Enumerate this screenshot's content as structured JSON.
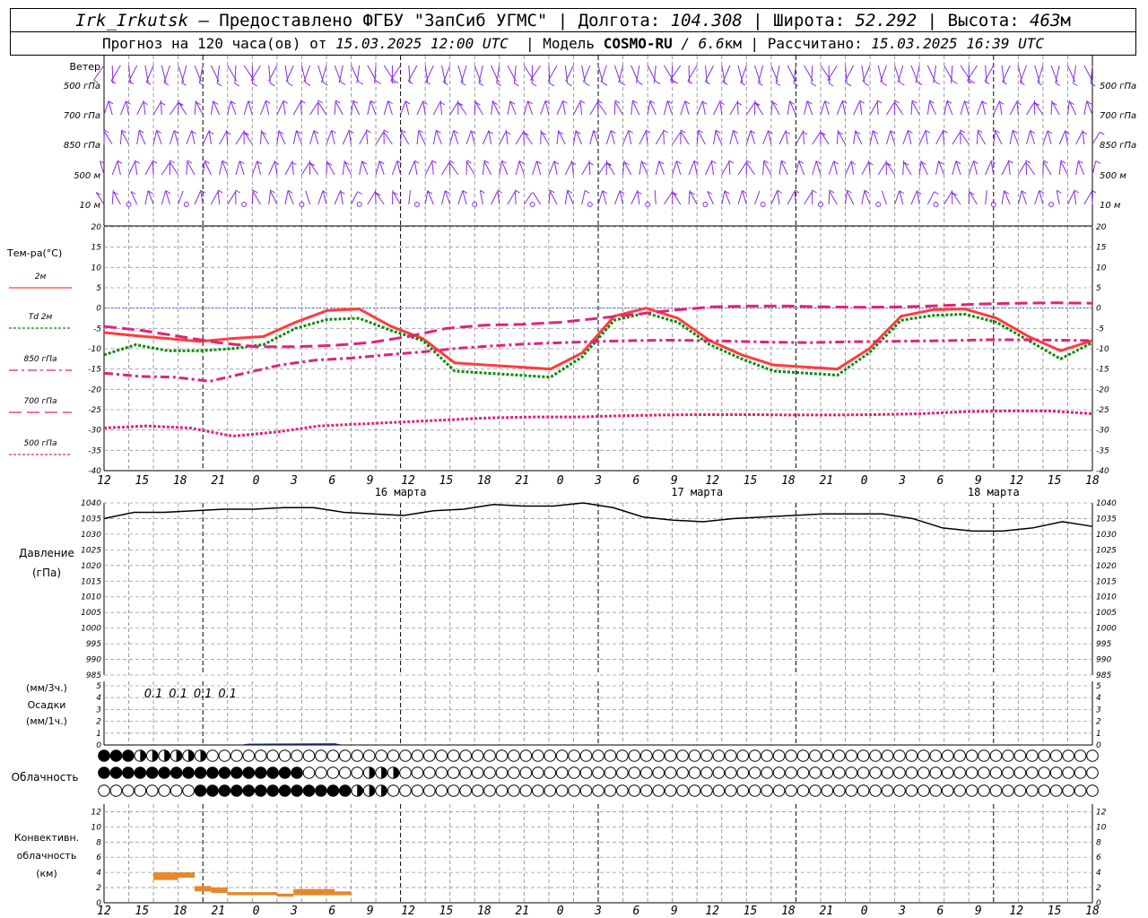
{
  "header": {
    "station": "Irk_Irkutsk",
    "provider": "— Предоставлено ФГБУ \"ЗапСиб УГМС\"",
    "lon_label": "Долгота:",
    "lon": "104.308",
    "lat_label": "Широта:",
    "lat": "52.292",
    "alt_label": "Высота:",
    "alt": "463",
    "alt_unit": "м",
    "forecast_label": "Прогноз на 120 часа(ов) от",
    "forecast_start": "15.03.2025 12:00 UTC",
    "model_label": "Модель",
    "model": "COSMO-RU",
    "resolution": "/ 6.6",
    "res_unit": "км",
    "calc_label": "Рассчитано:",
    "calc_time": "15.03.2025 16:39 UTC"
  },
  "chart_data": [
    {
      "type": "wind-barbs",
      "title": "Ветер",
      "levels": [
        "500 гПа",
        "700 гПа",
        "850 гПа",
        "500 м",
        "10 м"
      ]
    },
    {
      "type": "line",
      "ylabel": "Тем-ра(°C)",
      "ylim": [
        -40,
        20
      ],
      "yticks": [
        20,
        15,
        10,
        5,
        0,
        -5,
        -10,
        -15,
        -20,
        -25,
        -30,
        -35,
        -40
      ],
      "x_hours_from_start": [
        0,
        3,
        6,
        9,
        12,
        15,
        18,
        21,
        24,
        27,
        30,
        33,
        36,
        39,
        42,
        45,
        48,
        51,
        54,
        57,
        60,
        63,
        66,
        69,
        72,
        75,
        78,
        81,
        84,
        87,
        90,
        93,
        96,
        99,
        102,
        105,
        108,
        111,
        114,
        117,
        120
      ],
      "series": [
        {
          "name": "2м",
          "color": "#ff3c3c",
          "style": "solid",
          "values": [
            -6,
            -6.8,
            -7.5,
            -8.2,
            -7.5,
            -7,
            -3.5,
            -0.6,
            -0.2,
            -4.5,
            -7.5,
            -13.5,
            -14,
            -14.5,
            -15,
            -11,
            -2,
            0,
            -2.5,
            -8,
            -11.5,
            -14,
            -14.5,
            -15,
            -10,
            -2,
            -0.4,
            -0.2,
            -2.5,
            -7,
            -10.5,
            -8
          ]
        },
        {
          "name": "Td 2м",
          "color": "#0a8a0a",
          "style": "dotted",
          "values": [
            -11.5,
            -9,
            -10.5,
            -10.5,
            -10,
            -9,
            -5,
            -2.8,
            -2.5,
            -5.5,
            -8,
            -15.5,
            -16,
            -16.5,
            -17,
            -12,
            -3,
            -1.2,
            -3.5,
            -9,
            -12.5,
            -15.5,
            -16,
            -16.5,
            -11,
            -3,
            -1.8,
            -1.5,
            -3.5,
            -8,
            -12.5,
            -8.5
          ]
        },
        {
          "name": "850 гПа",
          "color": "#e0237a",
          "style": "dashdot",
          "values": [
            -16,
            -16.8,
            -17,
            -18,
            -16,
            -14,
            -12.8,
            -12.3,
            -11.5,
            -10.8,
            -9.9,
            -9.3,
            -8.8,
            -8.5,
            -8.2,
            -8,
            -7.9,
            -8,
            -8.2,
            -8.4,
            -8.5,
            -8.3,
            -8.2,
            -8.1,
            -8,
            -7.8,
            -7.8,
            -7.9,
            -8
          ]
        },
        {
          "name": "700 гПа",
          "color": "#e0237a",
          "style": "dashed",
          "values": [
            -4.5,
            -5.5,
            -7,
            -8.5,
            -9.5,
            -9.5,
            -9.2,
            -8.5,
            -7,
            -5,
            -4.2,
            -4,
            -3.5,
            -2.5,
            -1.5,
            -0.5,
            0.3,
            0.5,
            0.5,
            0.3,
            0.2,
            0.3,
            0.6,
            1,
            1.2,
            1.3,
            1.2
          ]
        },
        {
          "name": "500 гПа",
          "color": "#e0237a",
          "style": "dotted",
          "values": [
            -29.5,
            -29,
            -29.5,
            -31.5,
            -30.5,
            -29,
            -28.5,
            -28,
            -27.5,
            -27,
            -26.8,
            -26.8,
            -26.5,
            -26.3,
            -26.2,
            -26.2,
            -26.3,
            -26.3,
            -26.2,
            -26,
            -25.5,
            -25.3,
            -25.3,
            -26
          ]
        }
      ]
    },
    {
      "type": "line",
      "ylabel": "Давление",
      "yunit": "(гПа)",
      "ylim": [
        985,
        1040
      ],
      "yticks": [
        1040,
        1035,
        1030,
        1025,
        1020,
        1015,
        1010,
        1005,
        1000,
        995,
        990,
        985
      ],
      "x_hours_from_start": [
        0,
        3,
        6,
        9,
        12,
        15,
        18,
        21,
        24,
        27,
        30,
        33,
        36,
        39,
        42,
        45,
        48,
        51,
        54,
        57,
        60,
        63,
        66,
        69,
        72,
        75,
        78,
        81,
        84,
        87,
        90,
        93,
        96,
        99,
        102,
        105,
        108,
        111,
        114,
        117,
        120
      ],
      "series": [
        {
          "name": "Давление",
          "color": "#000000",
          "values": [
            1035,
            1037,
            1037,
            1037.5,
            1038,
            1038,
            1038.5,
            1038.5,
            1037,
            1036.5,
            1036,
            1037.5,
            1038,
            1039.5,
            1039,
            1039,
            1040,
            1038.5,
            1035.5,
            1034.5,
            1034,
            1035,
            1035.5,
            1036,
            1036.5,
            1036.5,
            1036.5,
            1035,
            1032,
            1031,
            1031,
            1032,
            1034,
            1032.5
          ]
        }
      ]
    },
    {
      "type": "bar",
      "ylabel": "Осадки",
      "yunit_top": "(мм/3ч.)",
      "yunit_bottom": "(мм/1ч.)",
      "ylim": [
        0,
        5
      ],
      "yticks": [
        5,
        4,
        3,
        2,
        1,
        0
      ],
      "labels": [
        "0.1",
        "0.1",
        "0.1",
        "0.1"
      ],
      "label_hours": [
        33,
        36,
        39,
        42
      ]
    },
    {
      "type": "cloud-circles",
      "ylabel": "Облачность",
      "rows": 3
    },
    {
      "type": "bar",
      "ylabel": "Конвективн. облачность (км)",
      "ylim": [
        0,
        13
      ],
      "yticks": [
        12,
        10,
        8,
        6,
        4,
        2,
        0
      ],
      "segments": [
        {
          "h0": 18,
          "h1": 21,
          "top": 4,
          "bottom": 3
        },
        {
          "h0": 21,
          "h1": 23,
          "top": 4,
          "bottom": 3.3
        },
        {
          "h0": 23,
          "h1": 25,
          "top": 2.2,
          "bottom": 1.5
        },
        {
          "h0": 25,
          "h1": 27,
          "top": 2,
          "bottom": 1.3
        },
        {
          "h0": 27,
          "h1": 33,
          "top": 1.4,
          "bottom": 1.0
        },
        {
          "h0": 33,
          "h1": 35,
          "top": 1.2,
          "bottom": 0.8
        },
        {
          "h0": 35,
          "h1": 40,
          "top": 1.8,
          "bottom": 1.0
        },
        {
          "h0": 40,
          "h1": 42,
          "top": 1.5,
          "bottom": 1.0
        }
      ]
    }
  ],
  "time_axis": {
    "tick_labels": [
      "12",
      "15",
      "18",
      "21",
      "0",
      "3",
      "6",
      "9",
      "12",
      "15",
      "18",
      "21",
      "0",
      "3",
      "6",
      "9",
      "12",
      "15",
      "18",
      "21",
      "0",
      "3",
      "6",
      "9",
      "12",
      "15",
      "18"
    ],
    "day_labels": [
      "16 марта",
      "17 марта",
      "18 марта"
    ]
  },
  "colors": {
    "wind": "#8a2be2",
    "precip": "#2244cc",
    "convective": "#e8862a",
    "grid": "#9a9a9a"
  }
}
